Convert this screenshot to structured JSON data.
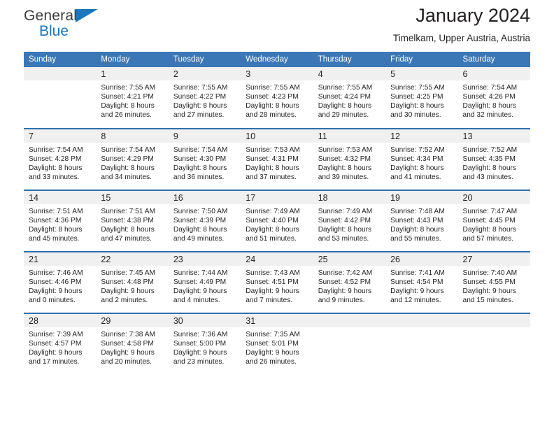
{
  "brand": {
    "name_top": "General",
    "name_bottom": "Blue",
    "accent_color": "#1b76bc"
  },
  "header": {
    "title": "January 2024",
    "subtitle": "Timelkam, Upper Austria, Austria"
  },
  "calendar": {
    "header_bg": "#3b77b6",
    "header_text_color": "#ffffff",
    "row_divider_color": "#2f6fae",
    "daynum_bg": "#f0f0f0",
    "weekdays": [
      "Sunday",
      "Monday",
      "Tuesday",
      "Wednesday",
      "Thursday",
      "Friday",
      "Saturday"
    ],
    "weeks": [
      [
        {
          "day": "",
          "sunrise": "",
          "sunset": "",
          "daylight1": "",
          "daylight2": ""
        },
        {
          "day": "1",
          "sunrise": "Sunrise: 7:55 AM",
          "sunset": "Sunset: 4:21 PM",
          "daylight1": "Daylight: 8 hours",
          "daylight2": "and 26 minutes."
        },
        {
          "day": "2",
          "sunrise": "Sunrise: 7:55 AM",
          "sunset": "Sunset: 4:22 PM",
          "daylight1": "Daylight: 8 hours",
          "daylight2": "and 27 minutes."
        },
        {
          "day": "3",
          "sunrise": "Sunrise: 7:55 AM",
          "sunset": "Sunset: 4:23 PM",
          "daylight1": "Daylight: 8 hours",
          "daylight2": "and 28 minutes."
        },
        {
          "day": "4",
          "sunrise": "Sunrise: 7:55 AM",
          "sunset": "Sunset: 4:24 PM",
          "daylight1": "Daylight: 8 hours",
          "daylight2": "and 29 minutes."
        },
        {
          "day": "5",
          "sunrise": "Sunrise: 7:55 AM",
          "sunset": "Sunset: 4:25 PM",
          "daylight1": "Daylight: 8 hours",
          "daylight2": "and 30 minutes."
        },
        {
          "day": "6",
          "sunrise": "Sunrise: 7:54 AM",
          "sunset": "Sunset: 4:26 PM",
          "daylight1": "Daylight: 8 hours",
          "daylight2": "and 32 minutes."
        }
      ],
      [
        {
          "day": "7",
          "sunrise": "Sunrise: 7:54 AM",
          "sunset": "Sunset: 4:28 PM",
          "daylight1": "Daylight: 8 hours",
          "daylight2": "and 33 minutes."
        },
        {
          "day": "8",
          "sunrise": "Sunrise: 7:54 AM",
          "sunset": "Sunset: 4:29 PM",
          "daylight1": "Daylight: 8 hours",
          "daylight2": "and 34 minutes."
        },
        {
          "day": "9",
          "sunrise": "Sunrise: 7:54 AM",
          "sunset": "Sunset: 4:30 PM",
          "daylight1": "Daylight: 8 hours",
          "daylight2": "and 36 minutes."
        },
        {
          "day": "10",
          "sunrise": "Sunrise: 7:53 AM",
          "sunset": "Sunset: 4:31 PM",
          "daylight1": "Daylight: 8 hours",
          "daylight2": "and 37 minutes."
        },
        {
          "day": "11",
          "sunrise": "Sunrise: 7:53 AM",
          "sunset": "Sunset: 4:32 PM",
          "daylight1": "Daylight: 8 hours",
          "daylight2": "and 39 minutes."
        },
        {
          "day": "12",
          "sunrise": "Sunrise: 7:52 AM",
          "sunset": "Sunset: 4:34 PM",
          "daylight1": "Daylight: 8 hours",
          "daylight2": "and 41 minutes."
        },
        {
          "day": "13",
          "sunrise": "Sunrise: 7:52 AM",
          "sunset": "Sunset: 4:35 PM",
          "daylight1": "Daylight: 8 hours",
          "daylight2": "and 43 minutes."
        }
      ],
      [
        {
          "day": "14",
          "sunrise": "Sunrise: 7:51 AM",
          "sunset": "Sunset: 4:36 PM",
          "daylight1": "Daylight: 8 hours",
          "daylight2": "and 45 minutes."
        },
        {
          "day": "15",
          "sunrise": "Sunrise: 7:51 AM",
          "sunset": "Sunset: 4:38 PM",
          "daylight1": "Daylight: 8 hours",
          "daylight2": "and 47 minutes."
        },
        {
          "day": "16",
          "sunrise": "Sunrise: 7:50 AM",
          "sunset": "Sunset: 4:39 PM",
          "daylight1": "Daylight: 8 hours",
          "daylight2": "and 49 minutes."
        },
        {
          "day": "17",
          "sunrise": "Sunrise: 7:49 AM",
          "sunset": "Sunset: 4:40 PM",
          "daylight1": "Daylight: 8 hours",
          "daylight2": "and 51 minutes."
        },
        {
          "day": "18",
          "sunrise": "Sunrise: 7:49 AM",
          "sunset": "Sunset: 4:42 PM",
          "daylight1": "Daylight: 8 hours",
          "daylight2": "and 53 minutes."
        },
        {
          "day": "19",
          "sunrise": "Sunrise: 7:48 AM",
          "sunset": "Sunset: 4:43 PM",
          "daylight1": "Daylight: 8 hours",
          "daylight2": "and 55 minutes."
        },
        {
          "day": "20",
          "sunrise": "Sunrise: 7:47 AM",
          "sunset": "Sunset: 4:45 PM",
          "daylight1": "Daylight: 8 hours",
          "daylight2": "and 57 minutes."
        }
      ],
      [
        {
          "day": "21",
          "sunrise": "Sunrise: 7:46 AM",
          "sunset": "Sunset: 4:46 PM",
          "daylight1": "Daylight: 9 hours",
          "daylight2": "and 0 minutes."
        },
        {
          "day": "22",
          "sunrise": "Sunrise: 7:45 AM",
          "sunset": "Sunset: 4:48 PM",
          "daylight1": "Daylight: 9 hours",
          "daylight2": "and 2 minutes."
        },
        {
          "day": "23",
          "sunrise": "Sunrise: 7:44 AM",
          "sunset": "Sunset: 4:49 PM",
          "daylight1": "Daylight: 9 hours",
          "daylight2": "and 4 minutes."
        },
        {
          "day": "24",
          "sunrise": "Sunrise: 7:43 AM",
          "sunset": "Sunset: 4:51 PM",
          "daylight1": "Daylight: 9 hours",
          "daylight2": "and 7 minutes."
        },
        {
          "day": "25",
          "sunrise": "Sunrise: 7:42 AM",
          "sunset": "Sunset: 4:52 PM",
          "daylight1": "Daylight: 9 hours",
          "daylight2": "and 9 minutes."
        },
        {
          "day": "26",
          "sunrise": "Sunrise: 7:41 AM",
          "sunset": "Sunset: 4:54 PM",
          "daylight1": "Daylight: 9 hours",
          "daylight2": "and 12 minutes."
        },
        {
          "day": "27",
          "sunrise": "Sunrise: 7:40 AM",
          "sunset": "Sunset: 4:55 PM",
          "daylight1": "Daylight: 9 hours",
          "daylight2": "and 15 minutes."
        }
      ],
      [
        {
          "day": "28",
          "sunrise": "Sunrise: 7:39 AM",
          "sunset": "Sunset: 4:57 PM",
          "daylight1": "Daylight: 9 hours",
          "daylight2": "and 17 minutes."
        },
        {
          "day": "29",
          "sunrise": "Sunrise: 7:38 AM",
          "sunset": "Sunset: 4:58 PM",
          "daylight1": "Daylight: 9 hours",
          "daylight2": "and 20 minutes."
        },
        {
          "day": "30",
          "sunrise": "Sunrise: 7:36 AM",
          "sunset": "Sunset: 5:00 PM",
          "daylight1": "Daylight: 9 hours",
          "daylight2": "and 23 minutes."
        },
        {
          "day": "31",
          "sunrise": "Sunrise: 7:35 AM",
          "sunset": "Sunset: 5:01 PM",
          "daylight1": "Daylight: 9 hours",
          "daylight2": "and 26 minutes."
        },
        {
          "day": "",
          "sunrise": "",
          "sunset": "",
          "daylight1": "",
          "daylight2": ""
        },
        {
          "day": "",
          "sunrise": "",
          "sunset": "",
          "daylight1": "",
          "daylight2": ""
        },
        {
          "day": "",
          "sunrise": "",
          "sunset": "",
          "daylight1": "",
          "daylight2": ""
        }
      ]
    ]
  }
}
